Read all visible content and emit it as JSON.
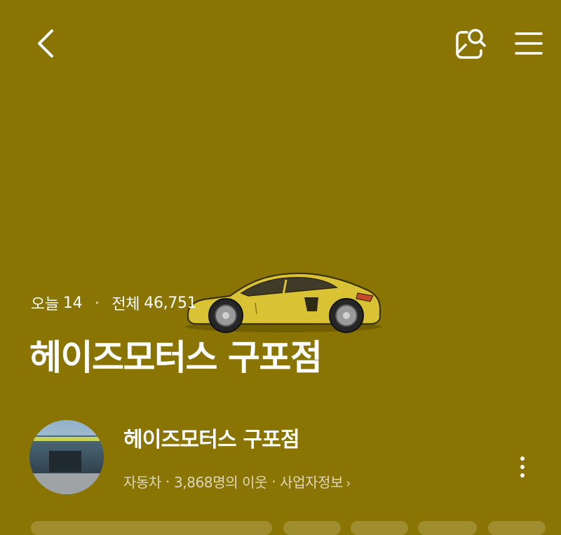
{
  "header": {
    "back_icon": "chevron-left-icon",
    "blog_search_icon": "blog-search-icon",
    "menu_icon": "hamburger-menu-icon"
  },
  "stats": {
    "today_label": "오늘",
    "today_value": "14",
    "separator": "·",
    "total_label": "전체",
    "total_value": "46,751"
  },
  "blog": {
    "title": "헤이즈모터스 구포점",
    "cover_image": "yellow-sports-car"
  },
  "profile": {
    "name": "헤이즈모터스 구포점",
    "category": "자동차",
    "neighbors": "3,868명의 이웃",
    "business_info": "사업자정보",
    "separator": "·",
    "more_icon": "more-vertical-icon"
  },
  "colors": {
    "background": "#8a7403",
    "text": "#ffffff"
  }
}
